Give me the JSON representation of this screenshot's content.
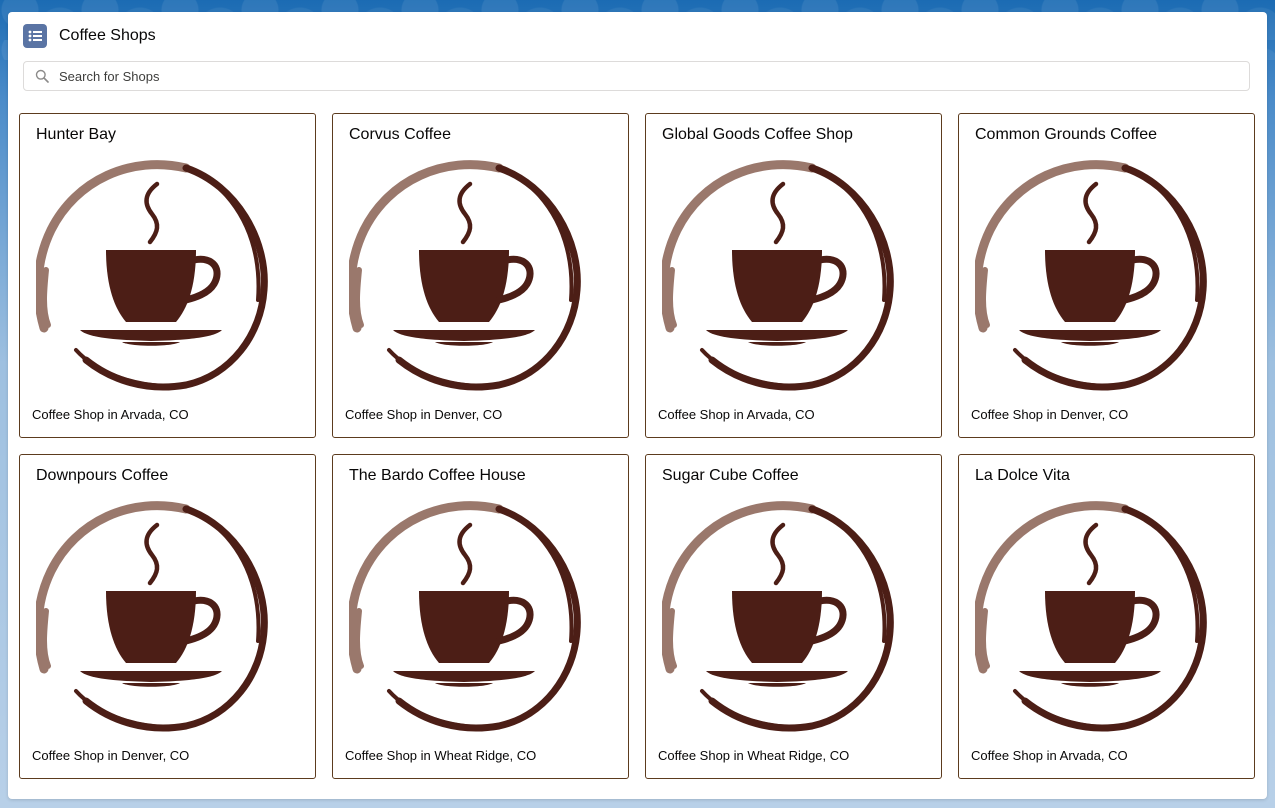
{
  "header": {
    "title": "Coffee Shops",
    "icon": "list-icon",
    "icon_color": "#5a74a4"
  },
  "search": {
    "placeholder": "Search for Shops",
    "value": ""
  },
  "colors": {
    "tile_border": "#5c3b1e",
    "logo_dark": "#4c1e16",
    "logo_light": "#9a786c"
  },
  "shops": [
    {
      "name": "Hunter Bay",
      "description": "Coffee Shop in Arvada, CO",
      "logo": "coffee-cup-logo"
    },
    {
      "name": "Corvus Coffee",
      "description": "Coffee Shop in Denver, CO",
      "logo": "coffee-cup-logo"
    },
    {
      "name": "Global Goods Coffee Shop",
      "description": "Coffee Shop in Arvada, CO",
      "logo": "coffee-cup-logo"
    },
    {
      "name": "Common Grounds Coffee",
      "description": "Coffee Shop in Denver, CO",
      "logo": "coffee-cup-logo"
    },
    {
      "name": "Downpours Coffee",
      "description": "Coffee Shop in Denver, CO",
      "logo": "coffee-cup-logo"
    },
    {
      "name": "The Bardo Coffee House",
      "description": "Coffee Shop in Wheat Ridge, CO",
      "logo": "coffee-cup-logo"
    },
    {
      "name": "Sugar Cube Coffee",
      "description": "Coffee Shop in Wheat Ridge, CO",
      "logo": "coffee-cup-logo"
    },
    {
      "name": "La Dolce Vita",
      "description": "Coffee Shop in Arvada, CO",
      "logo": "coffee-cup-logo"
    }
  ]
}
